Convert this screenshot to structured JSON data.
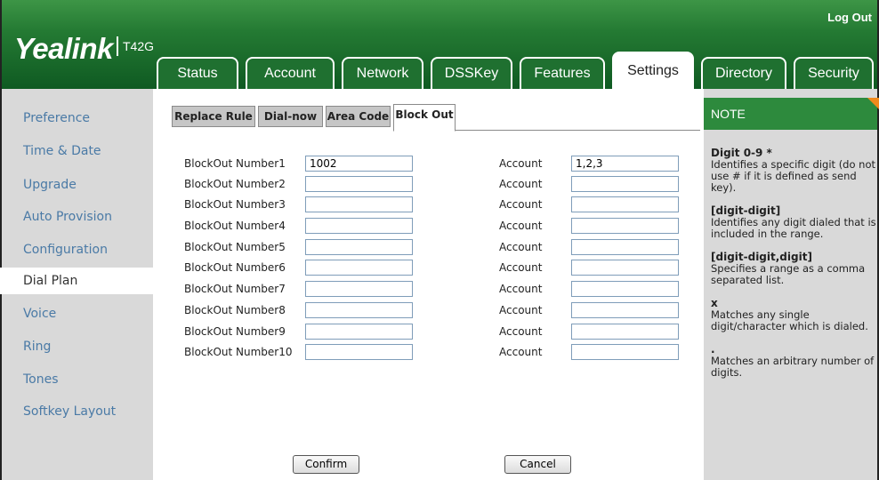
{
  "header": {
    "brand": "Yealink",
    "model": "T42G",
    "logout": "Log Out",
    "tabs": [
      "Status",
      "Account",
      "Network",
      "DSSKey",
      "Features",
      "Settings",
      "Directory",
      "Security"
    ],
    "active_tab": "Settings"
  },
  "sidebar": {
    "items": [
      "Preference",
      "Time & Date",
      "Upgrade",
      "Auto Provision",
      "Configuration",
      "Dial Plan",
      "Voice",
      "Ring",
      "Tones",
      "Softkey Layout"
    ],
    "active": "Dial Plan"
  },
  "subtabs": [
    "Replace Rule",
    "Dial-now",
    "Area Code",
    "Block Out"
  ],
  "active_subtab": "Block Out",
  "form": {
    "account_label": "Account",
    "rows": [
      {
        "label": "BlockOut Number1",
        "number": "1002",
        "account": "1,2,3"
      },
      {
        "label": "BlockOut Number2",
        "number": "",
        "account": ""
      },
      {
        "label": "BlockOut Number3",
        "number": "",
        "account": ""
      },
      {
        "label": "BlockOut Number4",
        "number": "",
        "account": ""
      },
      {
        "label": "BlockOut Number5",
        "number": "",
        "account": ""
      },
      {
        "label": "BlockOut Number6",
        "number": "",
        "account": ""
      },
      {
        "label": "BlockOut Number7",
        "number": "",
        "account": ""
      },
      {
        "label": "BlockOut Number8",
        "number": "",
        "account": ""
      },
      {
        "label": "BlockOut Number9",
        "number": "",
        "account": ""
      },
      {
        "label": "BlockOut Number10",
        "number": "",
        "account": ""
      }
    ],
    "confirm": "Confirm",
    "cancel": "Cancel"
  },
  "note": {
    "title": "NOTE",
    "sections": [
      {
        "title": "Digit 0-9 *",
        "text": "Identifies a specific digit (do not use # if it is defined as send key)."
      },
      {
        "title": "[digit-digit]",
        "text": "Identifies any digit dialed that is included in the range."
      },
      {
        "title": "[digit-digit,digit]",
        "text": "Specifies a range as a comma separated list."
      },
      {
        "title": "x",
        "text": "Matches any single digit/character which is dialed."
      },
      {
        "title": ".",
        "text": "Matches an arbitrary number of digits."
      }
    ]
  },
  "colors": {
    "header_green": "#247a33",
    "note_header": "#2d8a3d",
    "sidebar_bg": "#d9d9d9",
    "sidebar_link": "#4a7aa6",
    "note_corner": "#f08a1c"
  }
}
